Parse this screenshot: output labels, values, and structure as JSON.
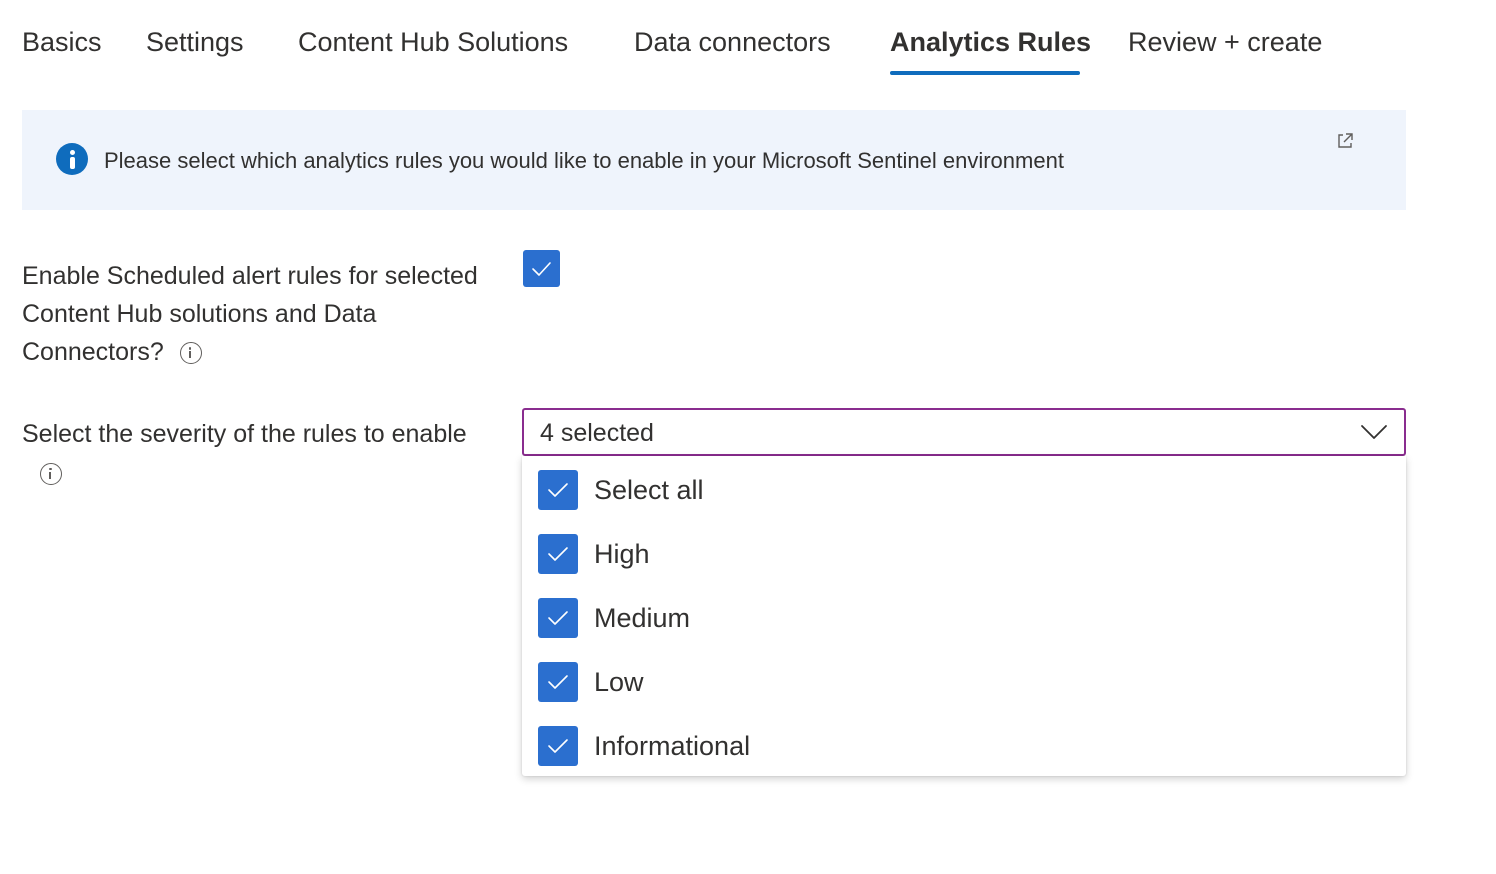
{
  "tabs": [
    {
      "label": "Basics",
      "active": false
    },
    {
      "label": "Settings",
      "active": false
    },
    {
      "label": "Content Hub Solutions",
      "active": false
    },
    {
      "label": "Data connectors",
      "active": false
    },
    {
      "label": "Analytics Rules",
      "active": true
    },
    {
      "label": "Review + create",
      "active": false
    }
  ],
  "banner": {
    "icon": "info-icon",
    "text": "Please select which analytics rules you would like to enable in your Microsoft Sentinel environment",
    "link_icon": "external-link-icon"
  },
  "form": {
    "enable_rules": {
      "label": "Enable Scheduled alert rules for selected Content Hub solutions and Data Connectors?",
      "checked": true
    },
    "severity": {
      "label": "Select the severity of the rules to enable",
      "value": "4 selected",
      "options": [
        {
          "label": "Select all",
          "checked": true
        },
        {
          "label": "High",
          "checked": true
        },
        {
          "label": "Medium",
          "checked": true
        },
        {
          "label": "Low",
          "checked": true
        },
        {
          "label": "Informational",
          "checked": true
        }
      ]
    }
  },
  "colors": {
    "accent": "#0f6cbd",
    "checkbox": "#2b6fcf",
    "focus_border": "#8a2d8f",
    "banner_bg": "#eff4fc"
  }
}
